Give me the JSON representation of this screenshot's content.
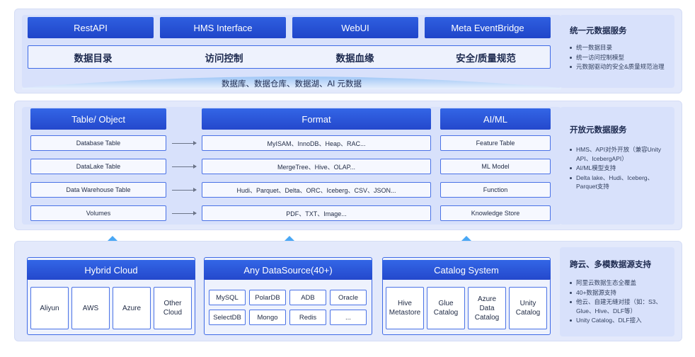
{
  "top": {
    "interfaces": [
      "RestAPI",
      "HMS Interface",
      "WebUI",
      "Meta EventBridge"
    ],
    "capabilities": [
      "数据目录",
      "访问控制",
      "数据血缘",
      "安全/质量规范"
    ],
    "sources_caption": "数据库、数据仓库、数据湖、AI 元数据",
    "side": {
      "title": "统一元数据服务",
      "items": [
        "统一数据目录",
        "统一访问控制模型",
        "元数据驱动的安全&质量规范治理"
      ]
    }
  },
  "middle": {
    "headers": {
      "left": "Table/ Object",
      "center": "Format",
      "right": "AI/ML"
    },
    "rows": [
      {
        "table": "Database Table",
        "format": "MyISAM、InnoDB、Heap、RAC...",
        "ai": "Feature Table"
      },
      {
        "table": "DataLake Table",
        "format": "MergeTree、Hive、OLAP...",
        "ai": "ML Model"
      },
      {
        "table": "Data Warehouse Table",
        "format": "Hudi、Parquet、Delta、ORC、Iceberg、CSV、JSON...",
        "ai": "Function"
      },
      {
        "table": "Volumes",
        "format": "PDF、TXT、Image...",
        "ai": "Knowledge Store"
      }
    ],
    "side": {
      "title": "开放元数据服务",
      "items": [
        "HMS、API对外开放（兼容Unity API、IcebergAPI）",
        "AI/ML模型支持",
        "Delta lake、Hudi、Iceberg、Parquet支持"
      ]
    }
  },
  "bottom": {
    "hybrid": {
      "title": "Hybrid Cloud",
      "tiles": [
        "Aliyun",
        "AWS",
        "Azure",
        "Other Cloud"
      ]
    },
    "datasource": {
      "title": "Any DataSource(40+)",
      "chips": [
        "MySQL",
        "PolarDB",
        "ADB",
        "Oracle",
        "SelectDB",
        "Mongo",
        "Redis",
        "..."
      ]
    },
    "catalog": {
      "title": "Catalog System",
      "tiles": [
        "Hive Metastore",
        "Glue Catalog",
        "Azure Data Catalog",
        "Unity Catalog"
      ]
    },
    "side": {
      "title": "跨云、多模数据源支持",
      "items": [
        "阿里云数据生态全覆盖",
        "40+数据源支持",
        "他云、自建无缝对接（如：S3、Glue、Hive、DLF等）",
        "Unity Catalog、DLF接入"
      ]
    }
  },
  "colors": {
    "primary": "#2a52d6",
    "panel": "#d8e1fb",
    "arrow": "#4aa8f5"
  }
}
